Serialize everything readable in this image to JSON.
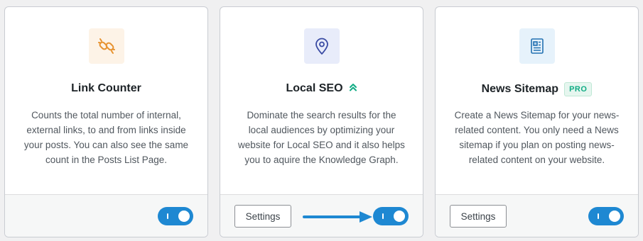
{
  "colors": {
    "toggle_on": "#1e88d2",
    "pro_badge": "#10ac84",
    "arrow": "#1e88d2"
  },
  "cards": [
    {
      "icon": "link-counter-icon",
      "title": "Link Counter",
      "description": "Counts the total number of internal, external links, to and from links inside your posts. You can also see the same count in the Posts List Page.",
      "has_settings": false,
      "enabled": true
    },
    {
      "icon": "location-pin-icon",
      "title": "Local SEO",
      "title_icon": "double-chevron-up-icon",
      "description": "Dominate the search results for the local audiences by optimizing your website for Local SEO and it also helps you to aquire the Knowledge Graph.",
      "settings_label": "Settings",
      "enabled": true
    },
    {
      "icon": "news-document-icon",
      "title": "News Sitemap",
      "badge": "PRO",
      "description": "Create a News Sitemap for your news-related content. You only need a News sitemap if you plan on posting news-related content on your website.",
      "settings_label": "Settings",
      "enabled": true
    }
  ]
}
